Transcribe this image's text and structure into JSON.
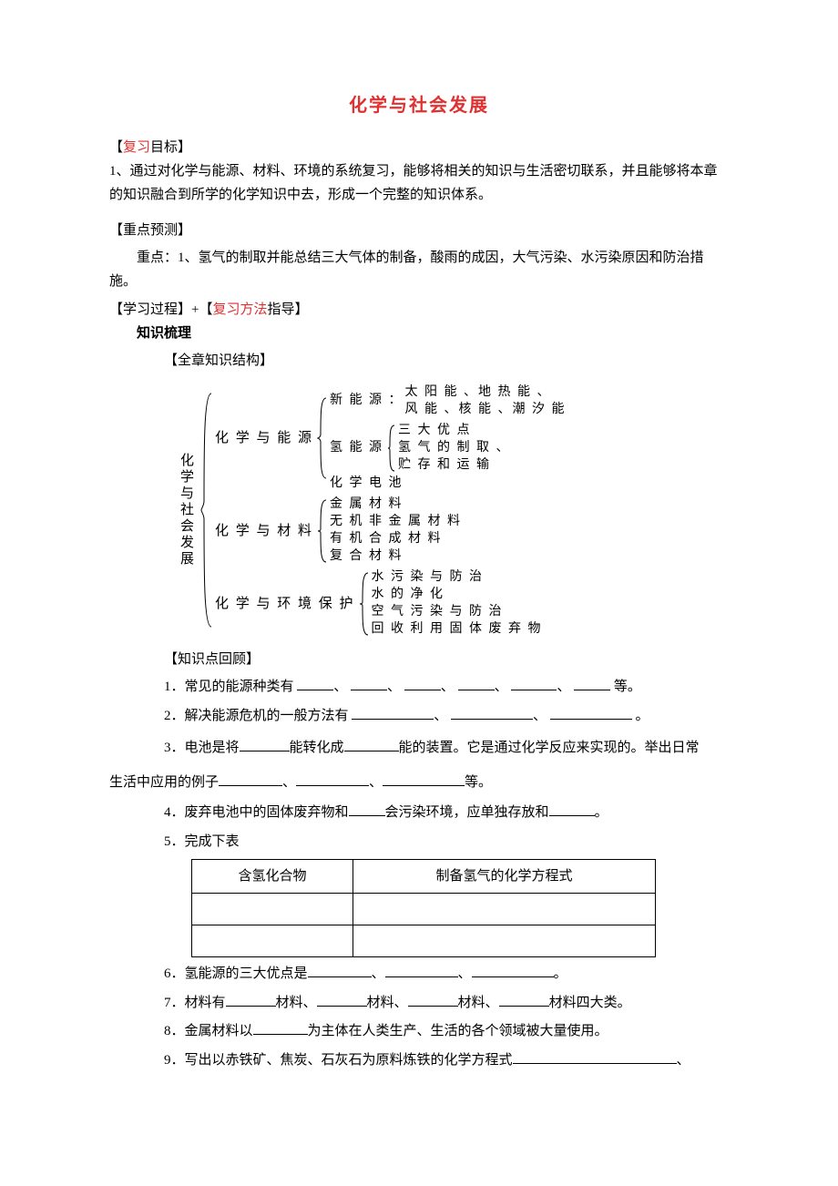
{
  "title": "化学与社会发展",
  "sections": {
    "goal_hdr_open": "【",
    "goal_hdr_red": "复习",
    "goal_hdr_rest": "目标】",
    "goal_body": "1、通过对化学与能源、材料、环境的系统复习，能够将相关的知识与生活密切联系，并且能够将本章的知识融合到所学的化学知识中去，形成一个完整的知识体系。",
    "kp_hdr": "【重点预测】",
    "kp_body": "重点：1、氢气的制取并能总结三大气体的制备，酸雨的成因，大气污染、水污染原因和防治措施。",
    "proc_hdr_a": "【学习过程】+【",
    "proc_hdr_red": "复习方法",
    "proc_hdr_b": "指导】",
    "tree_hdr": "知识梳理",
    "tree_sub": "【全章知识结构】",
    "review_hdr": "【知识点回顾】"
  },
  "hier": {
    "root": "化学与社会发展",
    "g1": "化 学 与 能 源",
    "g1_a_pre": "新 能 源 ：",
    "g1_a_l1": "太 阳 能 、地 热 能 、",
    "g1_a_l2": "风 能 、核 能 、潮 汐 能",
    "g1_b": "氢 能 源",
    "g1_b_l1": "三 大 优 点",
    "g1_b_l2": "氢 气 的 制 取 、",
    "g1_b_l3": "贮 存 和 运 输",
    "g1_c": "化 学 电 池",
    "g2": "化 学 与 材 料",
    "g2_l1": "金 属 材 料",
    "g2_l2": "无 机 非 金 属 材 料",
    "g2_l3": "有 机 合 成 材 料",
    "g2_l4": "复 合 材 料",
    "g3": "化 学 与 环 境 保 护",
    "g3_l1": "水 污 染 与 防 治",
    "g3_l2": "水 的 净 化",
    "g3_l3": "空 气 污 染 与 防 治",
    "g3_l4": "回 收 利 用 固 体 废 弃 物"
  },
  "questions": {
    "q1_a": "1．常见的能源种类有",
    "comma": "、",
    "q1_b": "等。",
    "q2_a": "2．解决能源危机的一般方法有",
    "q2_b": "。",
    "q3_a": "3．电池是将",
    "q3_b": "能转化成",
    "q3_c": "能的装置。它是通过化学反应来实现的。举出日常",
    "q3_d": "生活中应用的例子",
    "q3_e": "等。",
    "q4_a": "4．废弃电池中的固体废弃物和",
    "q4_b": "会污染环境，应单独存放和",
    "q4_c": "。",
    "q5": "5．完成下表",
    "q6_a": "6．氢能源的三大优点是",
    "q6_b": "。",
    "q7_a": "7．材料有",
    "q7_mid": "材料、",
    "q7_b": "材料四大类。",
    "q8_a": "8．金属材料以",
    "q8_b": "为主体在人类生产、生活的各个领域被大量使用。",
    "q9_a": "9．写出以赤铁矿、焦炭、石灰石为原料炼铁的化学方程式",
    "q9_b": "、"
  },
  "table": {
    "h1": "含氢化合物",
    "h2": "制备氢气的化学方程式"
  }
}
